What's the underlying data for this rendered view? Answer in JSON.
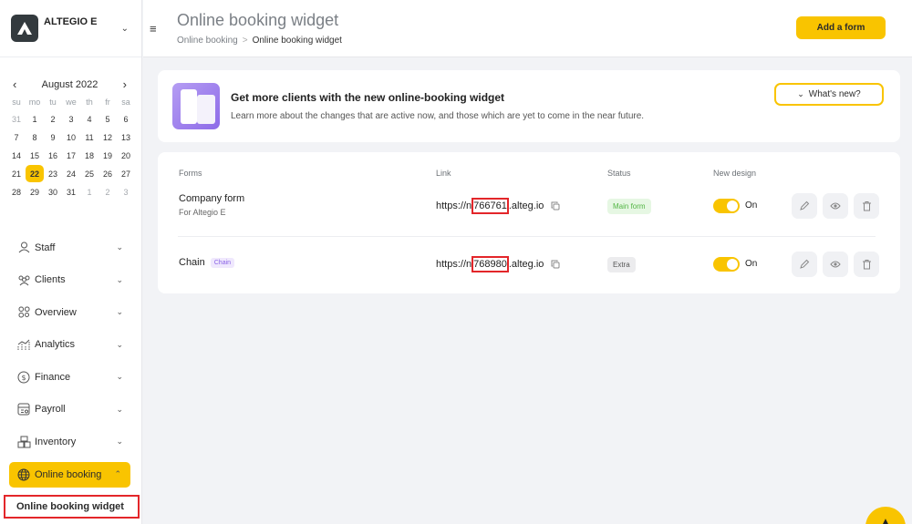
{
  "company": {
    "name": "ALTEGIO E"
  },
  "calendar": {
    "month": "August 2022",
    "weekdays": [
      "su",
      "mo",
      "tu",
      "we",
      "th",
      "fr",
      "sa"
    ],
    "weeks": [
      [
        "31",
        "1",
        "2",
        "3",
        "4",
        "5",
        "6"
      ],
      [
        "7",
        "8",
        "9",
        "10",
        "11",
        "12",
        "13"
      ],
      [
        "14",
        "15",
        "16",
        "17",
        "18",
        "19",
        "20"
      ],
      [
        "21",
        "22",
        "23",
        "24",
        "25",
        "26",
        "27"
      ],
      [
        "28",
        "29",
        "30",
        "31",
        "1",
        "2",
        "3"
      ]
    ],
    "today": "22"
  },
  "menu": [
    {
      "label": "Staff",
      "icon": "person-icon"
    },
    {
      "label": "Clients",
      "icon": "clients-icon"
    },
    {
      "label": "Overview",
      "icon": "overview-icon"
    },
    {
      "label": "Analytics",
      "icon": "analytics-icon"
    },
    {
      "label": "Finance",
      "icon": "finance-icon"
    },
    {
      "label": "Payroll",
      "icon": "payroll-icon"
    },
    {
      "label": "Inventory",
      "icon": "inventory-icon"
    },
    {
      "label": "Online booking",
      "icon": "globe-icon"
    }
  ],
  "submenu": {
    "label": "Online booking widget"
  },
  "header": {
    "title": "Online booking widget",
    "breadcrumb": [
      "Online booking",
      "Online booking widget"
    ],
    "breadcrumb_sep": ">",
    "add_button": "Add a form"
  },
  "banner": {
    "title": "Get more clients with the new online-booking widget",
    "subtitle": "Learn more about the changes that are active now, and those which are yet to come in the near future.",
    "button": "What's new?"
  },
  "table": {
    "headers": {
      "forms": "Forms",
      "link": "Link",
      "status": "Status",
      "new_design": "New design"
    },
    "rows": [
      {
        "name": "Company form",
        "sub": "For Altegio E",
        "badge": "",
        "link_prefix": "https://n",
        "link_id": "766761",
        "link_suffix": ".alteg.io",
        "status": "Main form",
        "design": "On"
      },
      {
        "name": "Chain",
        "sub": "",
        "badge": "Chain",
        "link_prefix": "https://n",
        "link_id": "768980",
        "link_suffix": ".alteg.io",
        "status": "Extra",
        "design": "On"
      }
    ]
  },
  "colors": {
    "accent": "#f9c400",
    "highlight": "#e3262a",
    "main_status": "#52b544",
    "chain_badge": "#8a62e6"
  }
}
